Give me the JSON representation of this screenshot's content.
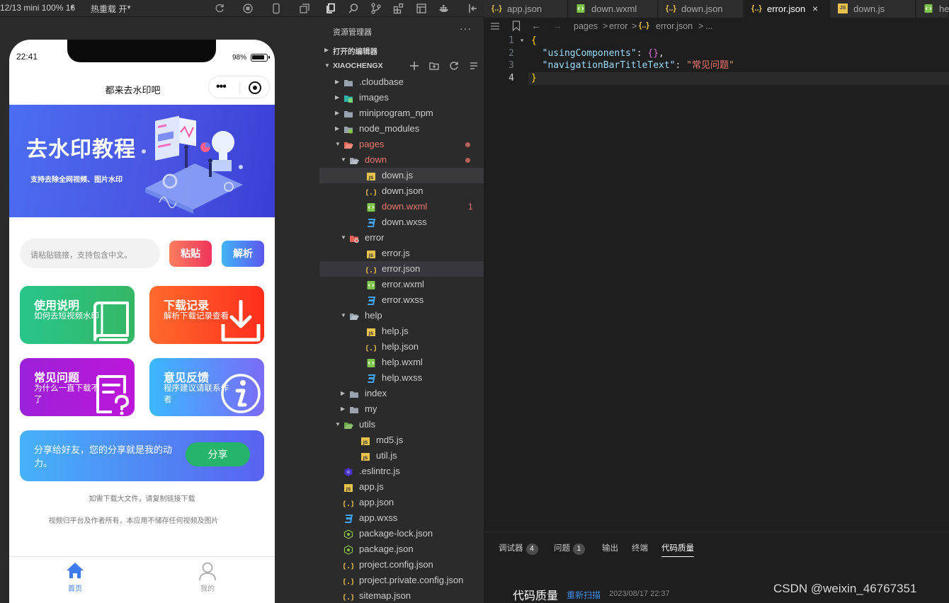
{
  "simulator": {
    "device": "12/13 mini 100% 16",
    "hot_reload": "热重载 开",
    "status_time": "22:41",
    "battery": "98%",
    "nav_title": "都来去水印吧",
    "banner_title": "去水印教程",
    "banner_sub": "支持去除全网视频、图片水印",
    "search_placeholder": "请粘贴链接，支持包含中文。",
    "paste_label": "粘贴",
    "parse_label": "解析",
    "cards": [
      {
        "title": "使用说明",
        "sub": "如何去短视频水印"
      },
      {
        "title": "下载记录",
        "sub": "解析下载记录查看"
      },
      {
        "title": "常见问题",
        "sub": "为什么一直下载不了"
      },
      {
        "title": "意见反馈",
        "sub": "程序建议请联系作者"
      }
    ],
    "share_text": "分享给好友，您的分享就是我的动力。",
    "share_button": "分享",
    "note1": "如需下载大文件，请复制链接下载",
    "note2": "视频归平台及作者所有，本应用不储存任何视频及图片",
    "tabbar": [
      {
        "label": "首页",
        "active": true
      },
      {
        "label": "我的",
        "active": false
      }
    ],
    "colors": {
      "tab_active": "#3d7cf0",
      "tab_inactive": "#999999"
    }
  },
  "explorer": {
    "title": "资源管理器",
    "more": "···",
    "open_editors": "打开的编辑器",
    "project": "XIAOCHENGX",
    "tree": [
      {
        "name": ".cloudbase",
        "type": "folder",
        "depth": 0,
        "open": false
      },
      {
        "name": "images",
        "type": "folder-img",
        "depth": 0,
        "open": false
      },
      {
        "name": "miniprogram_npm",
        "type": "folder",
        "depth": 0,
        "open": false
      },
      {
        "name": "node_modules",
        "type": "folder-node",
        "depth": 0,
        "open": false
      },
      {
        "name": "pages",
        "type": "folder-red",
        "depth": 0,
        "open": true,
        "red": true,
        "dot": true
      },
      {
        "name": "down",
        "type": "folder-open",
        "depth": 1,
        "open": true,
        "red": true,
        "dot": true
      },
      {
        "name": "down.js",
        "type": "js",
        "depth": 2,
        "sel": true
      },
      {
        "name": "down.json",
        "type": "json",
        "depth": 2
      },
      {
        "name": "down.wxml",
        "type": "wxml",
        "depth": 2,
        "red": true,
        "badge": "1"
      },
      {
        "name": "down.wxss",
        "type": "wxss",
        "depth": 2
      },
      {
        "name": "error",
        "type": "folder-err",
        "depth": 1,
        "open": true
      },
      {
        "name": "error.js",
        "type": "js",
        "depth": 2
      },
      {
        "name": "error.json",
        "type": "json",
        "depth": 2,
        "sel2": true
      },
      {
        "name": "error.wxml",
        "type": "wxml",
        "depth": 2
      },
      {
        "name": "error.wxss",
        "type": "wxss",
        "depth": 2
      },
      {
        "name": "help",
        "type": "folder-open",
        "depth": 1,
        "open": true
      },
      {
        "name": "help.js",
        "type": "js",
        "depth": 2
      },
      {
        "name": "help.json",
        "type": "json",
        "depth": 2
      },
      {
        "name": "help.wxml",
        "type": "wxml",
        "depth": 2
      },
      {
        "name": "help.wxss",
        "type": "wxss",
        "depth": 2
      },
      {
        "name": "index",
        "type": "folder",
        "depth": 1,
        "open": false
      },
      {
        "name": "my",
        "type": "folder",
        "depth": 1,
        "open": false
      },
      {
        "name": "utils",
        "type": "folder-utils",
        "depth": 0,
        "open": true
      },
      {
        "name": "md5.js",
        "type": "js",
        "depth": 1
      },
      {
        "name": "util.js",
        "type": "js",
        "depth": 1
      },
      {
        "name": ".eslintrc.js",
        "type": "eslint",
        "depth": 0
      },
      {
        "name": "app.js",
        "type": "js",
        "depth": 0
      },
      {
        "name": "app.json",
        "type": "json",
        "depth": 0
      },
      {
        "name": "app.wxss",
        "type": "wxss",
        "depth": 0
      },
      {
        "name": "package-lock.json",
        "type": "npm",
        "depth": 0
      },
      {
        "name": "package.json",
        "type": "npm",
        "depth": 0
      },
      {
        "name": "project.config.json",
        "type": "json",
        "depth": 0
      },
      {
        "name": "project.private.config.json",
        "type": "json",
        "depth": 0
      },
      {
        "name": "sitemap.json",
        "type": "json",
        "depth": 0
      }
    ]
  },
  "editor": {
    "tabs": [
      {
        "name": "app.json",
        "type": "json"
      },
      {
        "name": "down.wxml",
        "type": "wxml"
      },
      {
        "name": "down.json",
        "type": "json"
      },
      {
        "name": "error.json",
        "type": "json",
        "active": true,
        "close": "×"
      },
      {
        "name": "down.js",
        "type": "js"
      },
      {
        "name": "help",
        "type": "wxml"
      }
    ],
    "breadcrumb": [
      "pages",
      "error",
      "error.json",
      "..."
    ],
    "breadcrumb_sep": ">",
    "code": {
      "line_numbers": [
        "1",
        "2",
        "3",
        "4"
      ],
      "open_brace": "{",
      "key1": "\"usingComponents\"",
      "colon": ": ",
      "val1": "{}",
      "comma": ",",
      "key2": "\"navigationBarTitleText\"",
      "q": "\"",
      "val2": "常见问题",
      "close_brace": "}"
    }
  },
  "panel": {
    "tabs": [
      {
        "label": "调试器",
        "badge": "4"
      },
      {
        "label": "问题",
        "badge": "1"
      },
      {
        "label": "输出"
      },
      {
        "label": "终端"
      },
      {
        "label": "代码质量",
        "active": true
      }
    ],
    "quality_title": "代码质量",
    "rescan": "重新扫描",
    "time": "2023/08/17 22:37"
  },
  "watermark": "CSDN @weixin_46767351"
}
